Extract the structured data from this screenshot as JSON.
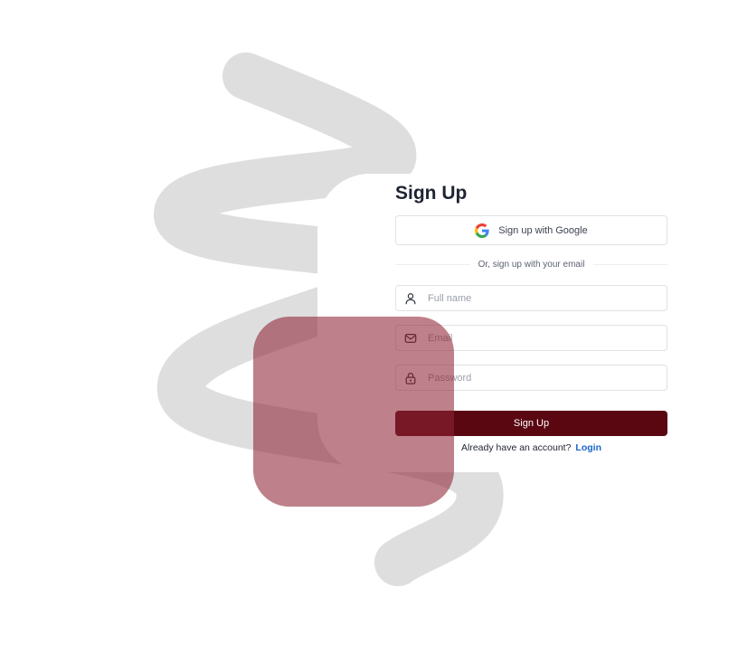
{
  "form": {
    "title": "Sign Up",
    "google_button": {
      "label": "Sign up with Google",
      "icon": "google-icon"
    },
    "divider_text": "Or, sign up with your email",
    "fields": [
      {
        "name": "full-name",
        "icon": "user-icon",
        "placeholder": "Full name",
        "value": ""
      },
      {
        "name": "email",
        "icon": "mail-icon",
        "placeholder": "Email",
        "value": ""
      },
      {
        "name": "password",
        "icon": "lock-icon",
        "placeholder": "Password",
        "value": ""
      }
    ],
    "submit_label": "Sign Up",
    "login_prompt": "Already have an account?",
    "login_link": "Login"
  },
  "colors": {
    "primary": "#5a0712",
    "link": "#1a66c9",
    "title": "#1f2433",
    "decor_stroke": "#dedede",
    "overlay": "#8f2436"
  }
}
